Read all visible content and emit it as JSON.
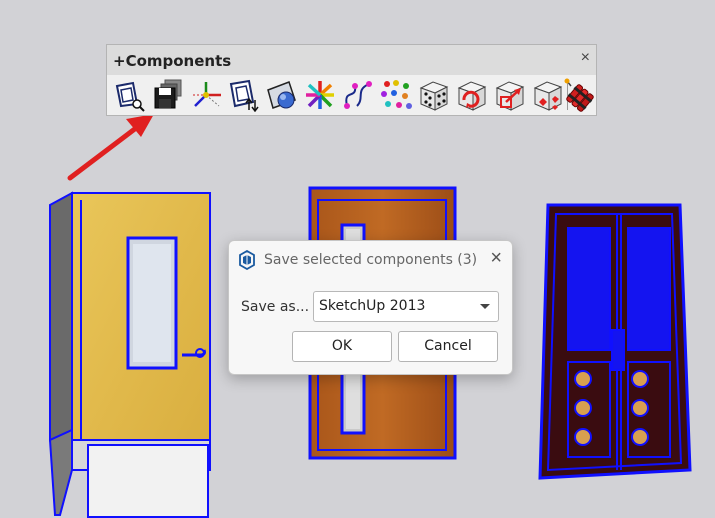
{
  "toolbar": {
    "title": "+Components",
    "close_glyph": "×",
    "icons": [
      "component-browser-icon",
      "save-components-icon",
      "axes-icon",
      "component-update-icon",
      "shape-sphere-icon",
      "color-wheel-icon",
      "paths-icon",
      "scatter-dots-icon",
      "dice-icon",
      "dice-refresh-icon",
      "dice-scale-icon",
      "dice-explode-icon",
      "dynamite-icon"
    ]
  },
  "dialog": {
    "title": "Save selected components (3)",
    "close_glyph": "×",
    "save_as_label": "Save as...",
    "save_as_value": "SketchUp 2013",
    "ok_label": "OK",
    "cancel_label": "Cancel"
  },
  "colors": {
    "selection_blue": "#1010ff",
    "arrow_red": "#e02020",
    "background": "#d2d2d6"
  }
}
